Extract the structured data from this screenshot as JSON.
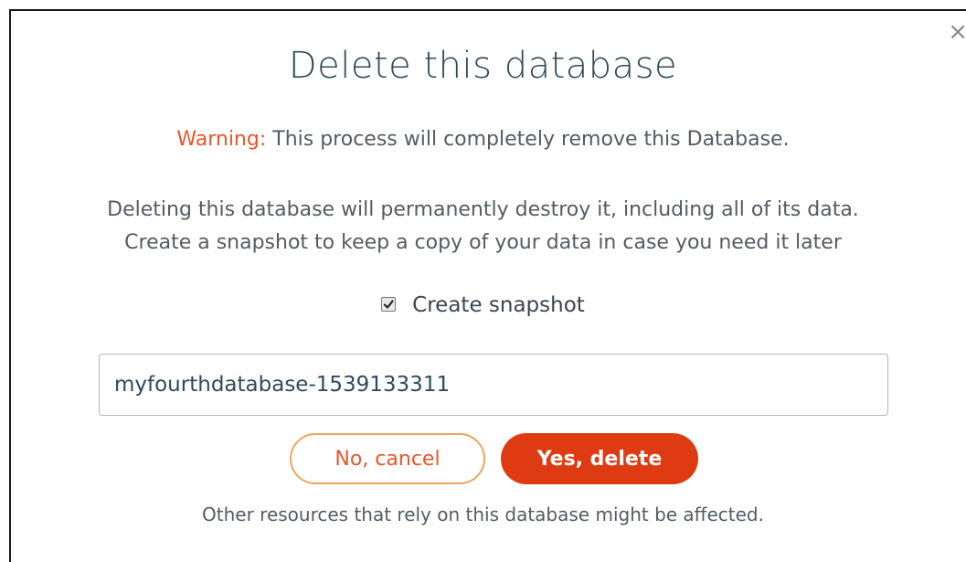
{
  "dialog": {
    "close_glyph": "×",
    "title": "Delete this database",
    "warning_label": "Warning:",
    "warning_text": " This process will completely remove this Database.",
    "description_line1": "Deleting this database will permanently destroy it, including all of its data.",
    "description_line2": "Create a snapshot to keep a copy of your data in case you need it later",
    "snapshot_checkbox": {
      "label": "Create snapshot",
      "checked": true
    },
    "snapshot_name_value": "myfourthdatabase-1539133311",
    "cancel_button": "No, cancel",
    "delete_button": "Yes, delete",
    "footnote": "Other resources that rely on this database might be affected."
  },
  "colors": {
    "title": "#2f4a5a",
    "warning_accent": "#e8562a",
    "delete_button_bg": "#df3b12",
    "cancel_border": "#f0a55a",
    "body_text": "#545b64"
  },
  "icons": {
    "close": "close-icon",
    "checkbox": "checkmark-icon"
  }
}
